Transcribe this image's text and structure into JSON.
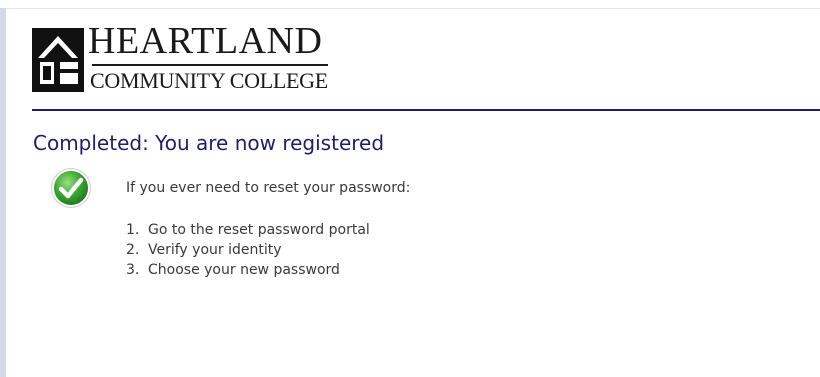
{
  "brand": {
    "name_line1": "HEARTLAND",
    "name_line2": "COMMUNITY COLLEGE",
    "accent_color": "#1b1f6b"
  },
  "page": {
    "title": "Completed:  You are now registered",
    "status_icon": "check-circle-icon",
    "intro": "If you ever need to reset your password:",
    "steps": [
      {
        "number": "1.",
        "text": "Go to the reset password portal"
      },
      {
        "number": "2.",
        "text": "Verify your identity"
      },
      {
        "number": "3.",
        "text": "Choose your new password"
      }
    ]
  }
}
